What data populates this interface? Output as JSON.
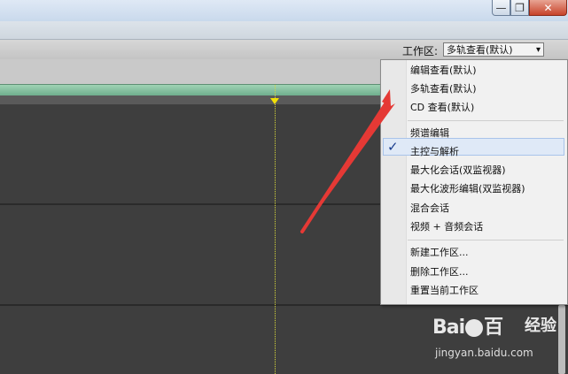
{
  "window": {
    "minimize_glyph": "—",
    "maximize_glyph": "❐",
    "close_glyph": "✕"
  },
  "toolbar": {
    "workspace_label": "工作区:",
    "workspace_selected": "多轨查看(默认)",
    "dropdown_arrow": "▾"
  },
  "menu": {
    "items": [
      {
        "label": "编辑查看(默认)",
        "checked": false
      },
      {
        "label": "多轨查看(默认)",
        "checked": true
      },
      {
        "label": "CD 查看(默认)",
        "checked": false
      },
      {
        "label": "频谱编辑",
        "checked": false
      },
      {
        "label": "主控与解析",
        "checked": false
      },
      {
        "label": "最大化会话(双监视器)",
        "checked": false
      },
      {
        "label": "最大化波形编辑(双监视器)",
        "checked": false
      },
      {
        "label": "混合会话",
        "checked": false
      },
      {
        "label": "视频 + 音频会话",
        "checked": false
      },
      {
        "label": "新建工作区...",
        "checked": false
      },
      {
        "label": "删除工作区...",
        "checked": false
      },
      {
        "label": "重置当前工作区",
        "checked": false
      }
    ],
    "check_glyph": "✓"
  },
  "watermark": {
    "logo_a": "Bai",
    "logo_b": "百",
    "logo_c": "经验",
    "url": "jingyan.baidu.com"
  },
  "colors": {
    "annotation_arrow": "#e53935",
    "timeline_bar": "#7fbf9b",
    "playhead": "#f6e100"
  }
}
